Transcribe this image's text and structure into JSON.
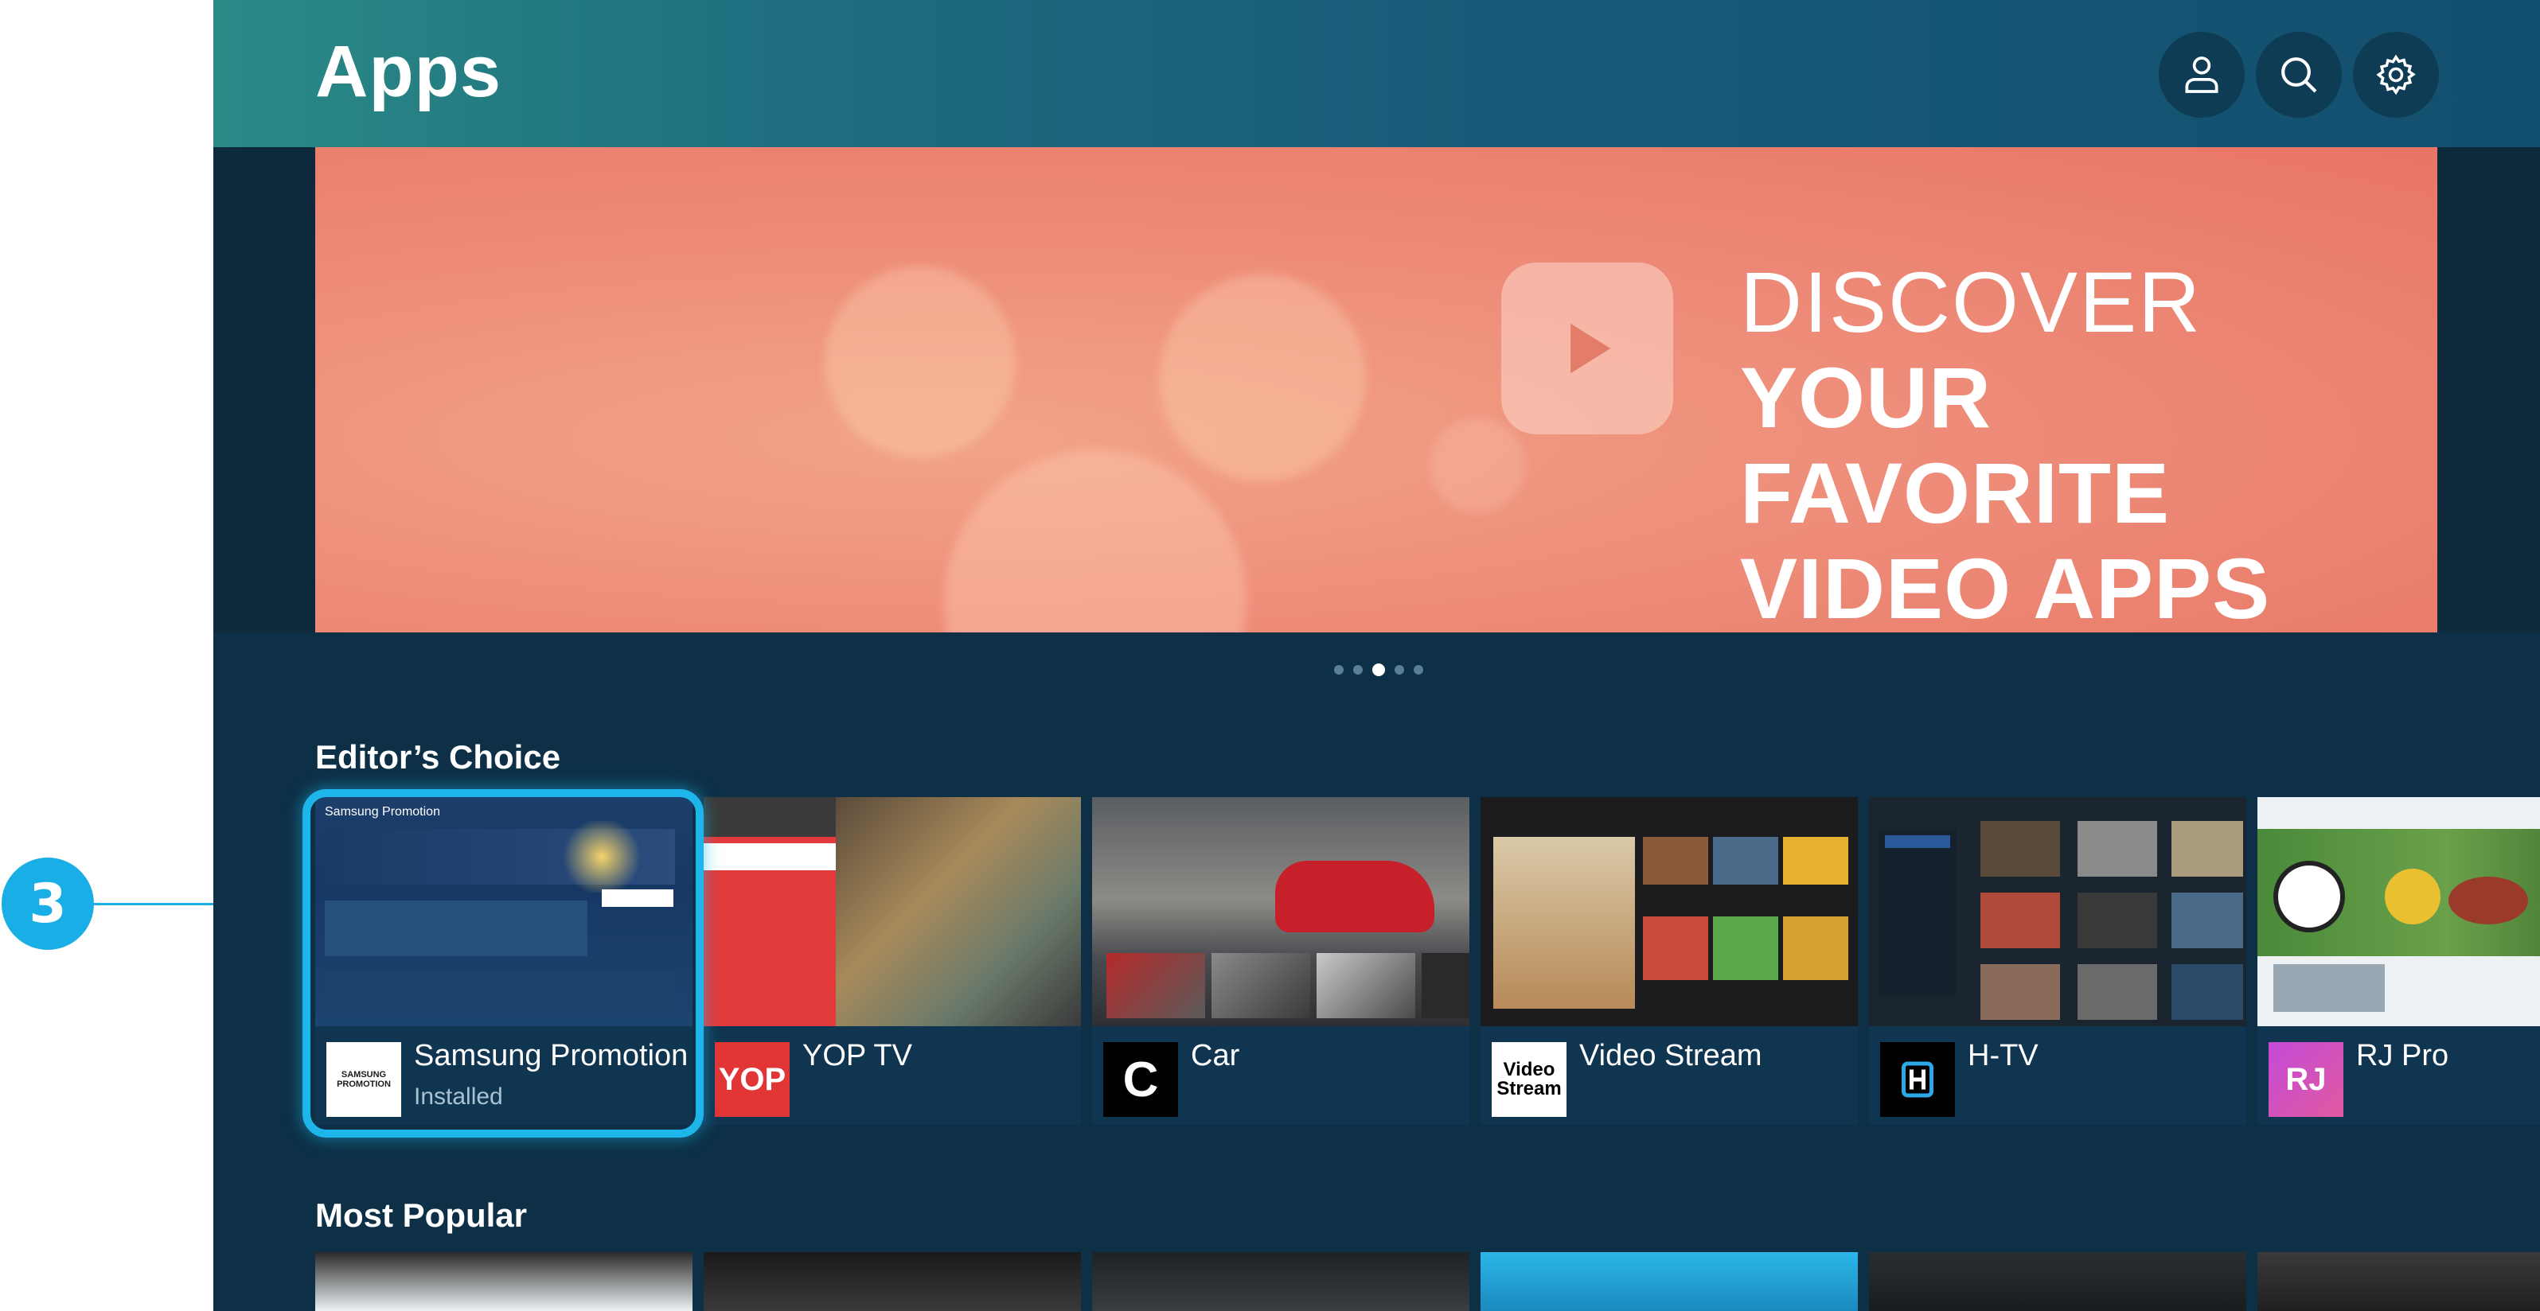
{
  "callout": {
    "number": "3"
  },
  "header": {
    "title": "Apps",
    "icons": [
      "user-icon",
      "search-icon",
      "gear-icon"
    ]
  },
  "banner": {
    "line1": "DISCOVER",
    "line2": "YOUR FAVORITE",
    "line3": "VIDEO APPS",
    "page_count": 5,
    "active_page": 3
  },
  "editors_choice": {
    "title": "Editor’s Choice",
    "apps": [
      {
        "name": "Samsung Promotion",
        "status": "Installed",
        "logo_text": "SAMSUNG PROMOTION",
        "focused": true
      },
      {
        "name": "YOP TV",
        "status": "",
        "logo_text": "YOP",
        "logo_color": "#e23535"
      },
      {
        "name": "Car",
        "status": "",
        "logo_text": "C",
        "logo_color": "#000000"
      },
      {
        "name": "Video Stream",
        "status": "",
        "logo_text": "Video Stream",
        "logo_color": "#ffffff"
      },
      {
        "name": "H-TV",
        "status": "",
        "logo_text": "H",
        "logo_color": "#000000"
      },
      {
        "name": "RJ Pro",
        "status": "",
        "logo_text": "RJ",
        "logo_color": "#b04ad8"
      }
    ]
  },
  "most_popular": {
    "title": "Most Popular"
  },
  "colors": {
    "accent": "#1eb6ea",
    "screen_bg": "#0d3047",
    "header_start": "#2a8a86",
    "banner": "#ee8d7a"
  }
}
